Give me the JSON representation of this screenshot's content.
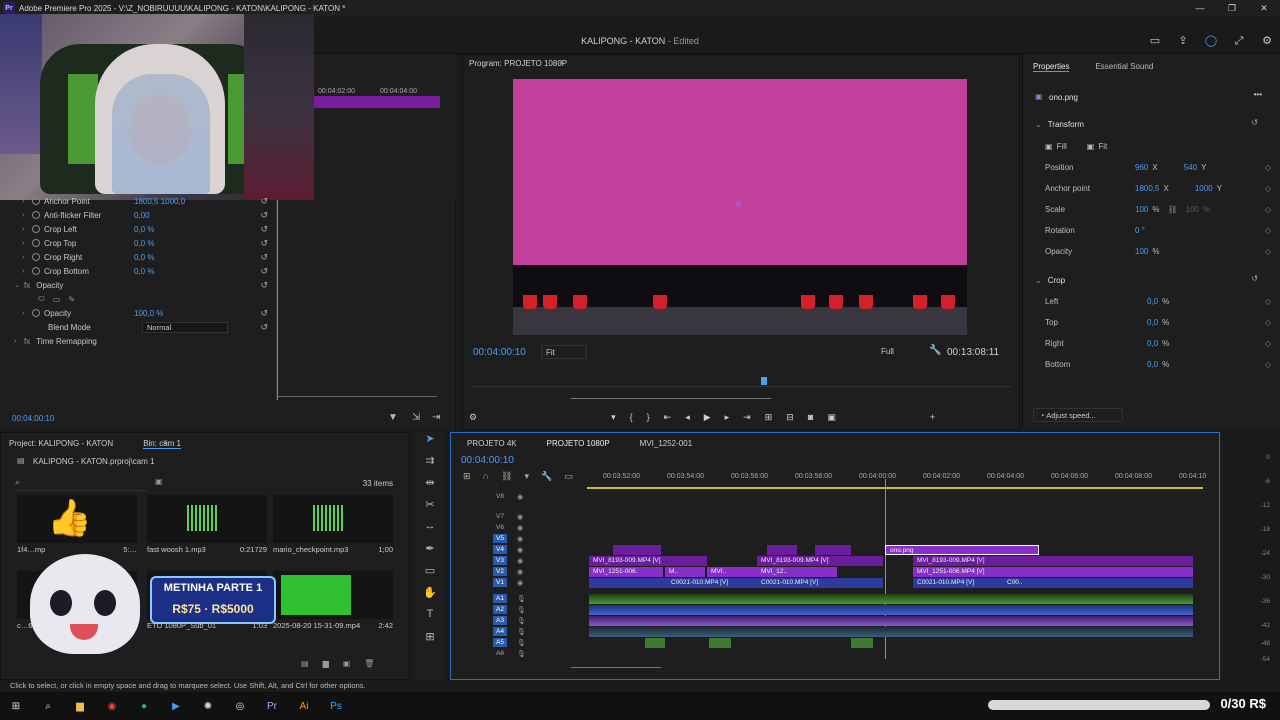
{
  "app": {
    "window_title": "Adobe Premiere Pro 2025 - V:\\Z_NOBIRUUUU\\KALIPONG - KATON\\KALIPONG - KATON *",
    "header_center": "KALIPONG - KATON",
    "header_status": "- Edited",
    "window_controls": [
      "—",
      "❐",
      "✕"
    ]
  },
  "source_monitor": {
    "tc1": "00:04:02:00",
    "tc2": "00:04:04:00"
  },
  "effect_controls": {
    "rows": [
      {
        "label": "Anchor Point",
        "value": "1800,5   1000,0"
      },
      {
        "label": "Anti-flicker Filter",
        "value": "0,00"
      },
      {
        "label": "Crop Left",
        "value": "0,0 %"
      },
      {
        "label": "Crop Top",
        "value": "0,0 %"
      },
      {
        "label": "Crop Right",
        "value": "0,0 %"
      },
      {
        "label": "Crop Bottom",
        "value": "0,0 %"
      }
    ],
    "opacity_section": "Opacity",
    "opacity_label": "Opacity",
    "opacity_value": "100,0 %",
    "blend_label": "Blend Mode",
    "blend_value": "Normal",
    "time_remap": "Time Remapping",
    "timecode": "00:04:00:10"
  },
  "program": {
    "title": "Program: PROJETO 1080P",
    "timecode": "00:04:00:10",
    "fit": "Fit",
    "quality": "Full",
    "duration": "00:13:08:11"
  },
  "properties": {
    "tab_properties": "Properties",
    "tab_essential": "Essential Sound",
    "clip_name": "ono.png",
    "transform": "Transform",
    "fill": "Fill",
    "fit": "Fit",
    "position": {
      "label": "Position",
      "x": "960",
      "y": "540",
      "ux": "X",
      "uy": "Y"
    },
    "anchor": {
      "label": "Anchor point",
      "x": "1800,5",
      "y": "1000",
      "ux": "X",
      "uy": "Y"
    },
    "scale": {
      "label": "Scale",
      "v": "100",
      "unit": "%",
      "v2": "100",
      "unit2": "%"
    },
    "rotation": {
      "label": "Rotation",
      "v": "0 °"
    },
    "opacity": {
      "label": "Opacity",
      "v": "100",
      "unit": "%"
    },
    "crop": "Crop",
    "crop_rows": [
      {
        "label": "Left",
        "v": "0,0",
        "unit": "%"
      },
      {
        "label": "Top",
        "v": "0,0",
        "unit": "%"
      },
      {
        "label": "Right",
        "v": "0,0",
        "unit": "%"
      },
      {
        "label": "Bottom",
        "v": "0,0",
        "unit": "%"
      }
    ],
    "adjust_speed": "Adjust speed..."
  },
  "project": {
    "tab_project": "Project: KALIPONG - KATON",
    "tab_bin": "Bin: cam 1",
    "path": "KALIPONG - KATON.prproj\\cam 1",
    "items_count": "33 items",
    "assets": [
      {
        "name": "1f4…mp",
        "dur": "5:…"
      },
      {
        "name": "fast woosh 1.mp3",
        "dur": "0:21729"
      },
      {
        "name": "mario_checkpoint.mp3",
        "dur": "1;00"
      },
      {
        "name": "c…68.png",
        "dur": ""
      },
      {
        "name": "ETO 1080P_Sub_01",
        "dur": "1:03"
      },
      {
        "name": "2025-08-20 15-31-09.mp4",
        "dur": "2:42"
      }
    ]
  },
  "promo": {
    "line1": "METINHA PARTE 1",
    "line2": "R$75 · R$5000"
  },
  "timeline": {
    "tabs": [
      "PROJETO 4K",
      "PROJETO 1080P",
      "MVI_1252-001"
    ],
    "timecode": "00:04:00:10",
    "ruler": [
      "00:03:52:00",
      "00:03:54:00",
      "00:03:56:00",
      "00:03:58:00",
      "00:04:00:00",
      "00:04:02:00",
      "00:04:04:00",
      "00:04:06:00",
      "00:04:08:00",
      "00:04:10"
    ],
    "tracks": [
      "V8",
      "V7",
      "V6",
      "V5",
      "V4",
      "V3",
      "V2",
      "V1",
      "A1",
      "A2",
      "A3",
      "A4",
      "A5",
      "A6"
    ],
    "clips": {
      "ono": "ono.png",
      "v3a": "MVI_8193-009.MP4 [V]",
      "v3b": "MVI_8193-009.MP4 [V]",
      "v3c": "MVI_8193-009.MP4 [V]",
      "v2a": "MVI_1251-006.",
      "v2b": "M..",
      "v2c": "MVI..",
      "v2d": "MVI_12..",
      "v2e": "MVI_1251-006.MP4 [V]",
      "v1a": "C0021-010.MP4 [V]",
      "v1b": "C0021-010.MP4 [V]",
      "v1c": "C0021-010.MP4 [V]",
      "v1d": "C00.."
    }
  },
  "meters": [
    "0",
    "-6",
    "-12",
    "-18",
    "-24",
    "-30",
    "-36",
    "-42",
    "-48",
    "-54"
  ],
  "status_bar": "Click to select, or click in empty space and drag to marquee select. Use Shift, Alt, and Ctrl for other options.",
  "donation": "0/30 R$",
  "colors": {
    "accent": "#4e9cf5",
    "video_clip": "#6a1e9e",
    "program_bg": "#c2409b"
  }
}
